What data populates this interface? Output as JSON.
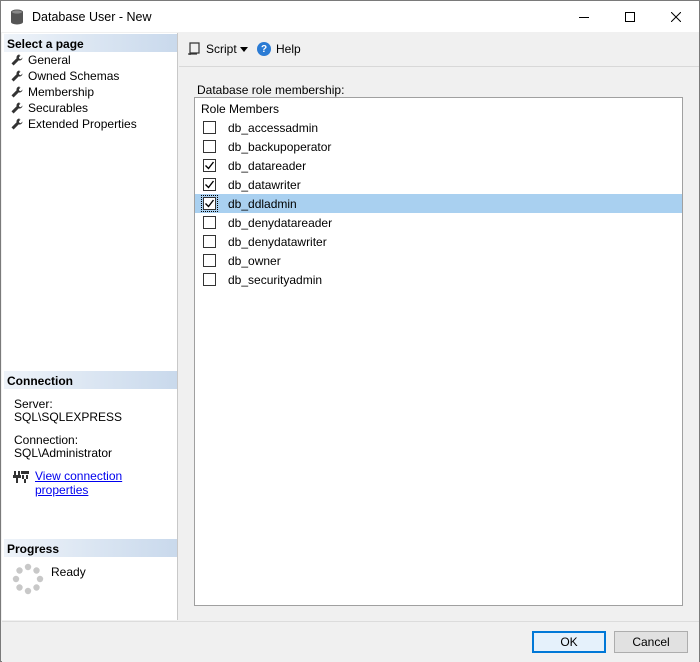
{
  "window": {
    "title": "Database User - New"
  },
  "left": {
    "select_page_header": "Select a page",
    "pages": [
      {
        "label": "General",
        "selected": false
      },
      {
        "label": "Owned Schemas",
        "selected": false
      },
      {
        "label": "Membership",
        "selected": true
      },
      {
        "label": "Securables",
        "selected": false
      },
      {
        "label": "Extended Properties",
        "selected": false
      }
    ],
    "connection_header": "Connection",
    "server_label": "Server:",
    "server_value": "SQL\\SQLEXPRESS",
    "connection_label": "Connection:",
    "connection_value": "SQL\\Administrator",
    "view_connection_link": "View connection properties",
    "progress_header": "Progress",
    "progress_status": "Ready"
  },
  "toolbar": {
    "script_label": "Script",
    "help_label": "Help"
  },
  "main": {
    "group_label": "Database role membership:",
    "list_header": "Role Members",
    "roles": [
      {
        "name": "db_accessadmin",
        "checked": false,
        "selected": false
      },
      {
        "name": "db_backupoperator",
        "checked": false,
        "selected": false
      },
      {
        "name": "db_datareader",
        "checked": true,
        "selected": false
      },
      {
        "name": "db_datawriter",
        "checked": true,
        "selected": false
      },
      {
        "name": "db_ddladmin",
        "checked": true,
        "selected": true
      },
      {
        "name": "db_denydatareader",
        "checked": false,
        "selected": false
      },
      {
        "name": "db_denydatawriter",
        "checked": false,
        "selected": false
      },
      {
        "name": "db_owner",
        "checked": false,
        "selected": false
      },
      {
        "name": "db_securityadmin",
        "checked": false,
        "selected": false
      }
    ]
  },
  "footer": {
    "ok_label": "OK",
    "cancel_label": "Cancel"
  },
  "colors": {
    "selection": "#a9d0f0",
    "link": "#0000ee",
    "accent": "#0078d7"
  }
}
